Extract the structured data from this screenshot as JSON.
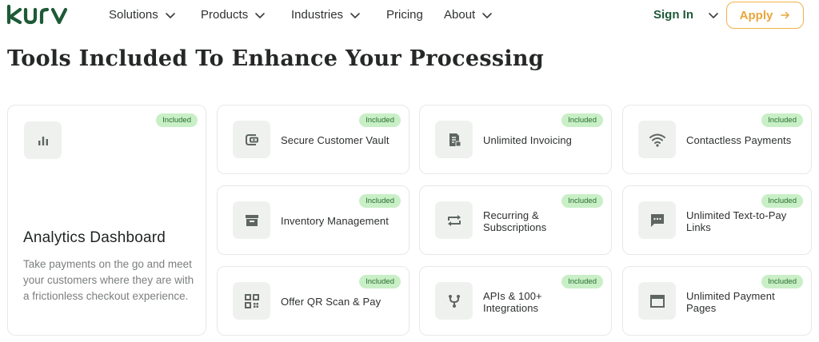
{
  "brand": {
    "name": "kurv",
    "color": "#1e5a37"
  },
  "nav": {
    "items": [
      {
        "label": "Solutions",
        "has_dropdown": true
      },
      {
        "label": "Products",
        "has_dropdown": true
      },
      {
        "label": "Industries",
        "has_dropdown": true
      },
      {
        "label": "Pricing",
        "has_dropdown": false
      },
      {
        "label": "About",
        "has_dropdown": true
      }
    ],
    "signin_label": "Sign In",
    "apply_label": "Apply",
    "apply_color": "#f0b24a"
  },
  "heading": "Tools Included To Enhance Your Processing",
  "badge_label": "Included",
  "badge_color": "#c8efc6",
  "featured": {
    "icon": "bar-chart-icon",
    "title": "Analytics Dashboard",
    "description": "Take payments on the go and meet your customers where they are with a frictionless checkout experience."
  },
  "features": [
    {
      "icon": "vault-icon",
      "label": "Secure Customer Vault"
    },
    {
      "icon": "invoice-icon",
      "label": "Unlimited Invoicing"
    },
    {
      "icon": "wifi-icon",
      "label": "Contactless Payments"
    },
    {
      "icon": "inventory-icon",
      "label": "Inventory Management"
    },
    {
      "icon": "repeat-icon",
      "label": "Recurring & Subscriptions"
    },
    {
      "icon": "chat-icon",
      "label": "Unlimited Text-to-Pay Links"
    },
    {
      "icon": "qr-icon",
      "label": "Offer QR Scan & Pay"
    },
    {
      "icon": "fork-icon",
      "label": "APIs & 100+ Integrations"
    },
    {
      "icon": "window-icon",
      "label": "Unlimited Payment Pages"
    }
  ]
}
